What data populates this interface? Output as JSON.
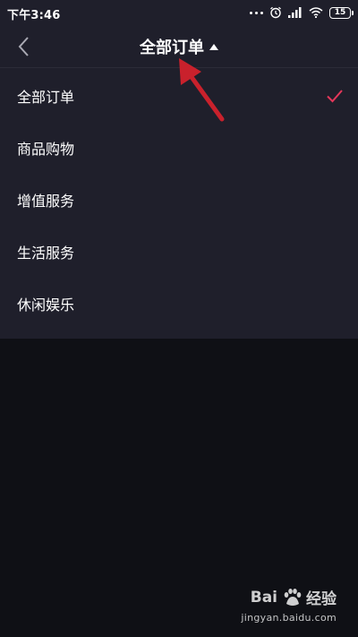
{
  "status_bar": {
    "time": "下午3:46",
    "battery": "15",
    "icons": [
      "dots-icon",
      "alarm-icon",
      "signal-icon",
      "wifi-icon",
      "battery-icon"
    ]
  },
  "header": {
    "title": "全部订单",
    "back_icon": "chevron-left-icon",
    "dropdown_icon": "caret-up-icon"
  },
  "menu": {
    "items": [
      {
        "label": "全部订单",
        "selected": true
      },
      {
        "label": "商品购物",
        "selected": false
      },
      {
        "label": "增值服务",
        "selected": false
      },
      {
        "label": "生活服务",
        "selected": false
      },
      {
        "label": "休闲娱乐",
        "selected": false
      }
    ],
    "check_color": "#e5375a"
  },
  "annotation": {
    "arrow_color": "#c9212c"
  },
  "watermark": {
    "brand_prefix": "Bai",
    "brand_suffix": "经验",
    "url": "jingyan.baidu.com"
  }
}
